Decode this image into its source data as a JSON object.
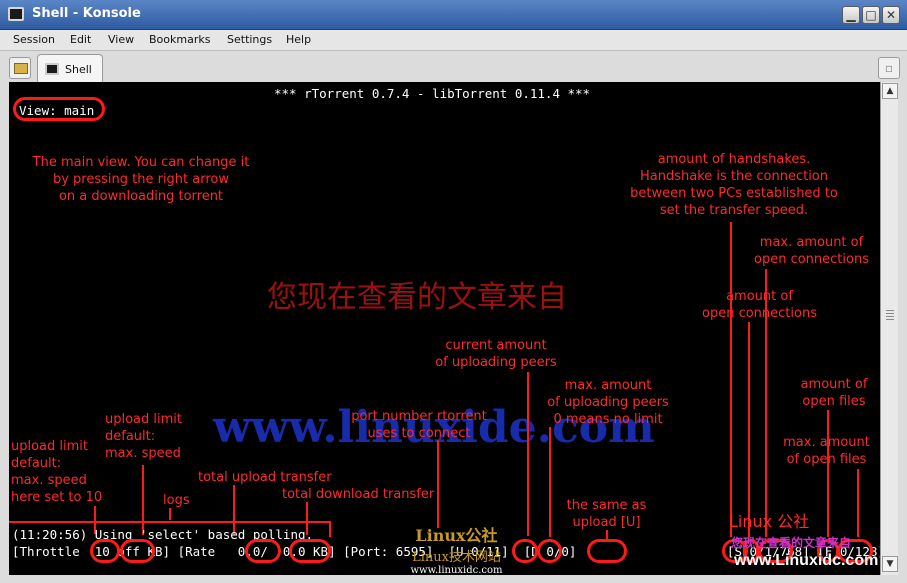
{
  "window": {
    "title": "Shell - Konsole"
  },
  "menu": [
    "Session",
    "Edit",
    "View",
    "Bookmarks",
    "Settings",
    "Help"
  ],
  "tab": {
    "label": "Shell"
  },
  "terminal": {
    "header": "*** rTorrent 0.7.4 - libTorrent 0.11.4 ***",
    "view": "View: main",
    "log_line": "(11:20:56) Using 'select' based polling.",
    "status_line": "[Throttle  10 off KB] [Rate   0.0/  0.0 KB] [Port: 6595]  [U 0/11]  [D 0/0]                    [S 0/1/768] [F 0/128]"
  },
  "annotations": {
    "main_view": [
      "The main view. You can change it",
      "by pressing the right arrow",
      "on a downloading torrent"
    ],
    "handshakes": [
      "amount of handshakes.",
      "Handshake is the connection",
      "between two PCs established to",
      "set the transfer speed."
    ],
    "max_open_connections": [
      "max. amount of",
      "open connections"
    ],
    "open_connections": [
      "amount of",
      "open connections"
    ],
    "current_uploading_peers": [
      "current amount",
      "of uploading peers"
    ],
    "max_uploading_peers": [
      "max. amount",
      "of uploading peers",
      "0 means no limit"
    ],
    "port": [
      "port number rtorrent",
      "uses to connect"
    ],
    "upload_limit_speed": [
      "upload limit",
      "default:",
      "max. speed"
    ],
    "upload_limit_10": [
      "upload limit",
      "default:",
      "max. speed",
      "here set to 10"
    ],
    "total_upload": "total upload transfer",
    "total_download": "total download transfer",
    "logs": "logs",
    "same_as_upload": [
      "the same as",
      "upload [U]"
    ],
    "open_files": [
      "amount of",
      "open files"
    ],
    "max_open_files": [
      "max. amount",
      "of open files"
    ]
  },
  "watermarks": {
    "cn_line": "您现在查看的文章来自",
    "site": "www.linuxide.com",
    "logo_top": "Linux公社",
    "logo_mid": "Linux技术网站",
    "logo_url": "www.linuxidc.com",
    "gongshe": "Linux 公社",
    "cn_small": "您现在查看的文章来自",
    "site_small": "www.Linuxidc.com"
  },
  "colors": {
    "annotation": "#ff2a2a",
    "terminal_bg": "#000000",
    "titlebar": "#3d69b0"
  }
}
